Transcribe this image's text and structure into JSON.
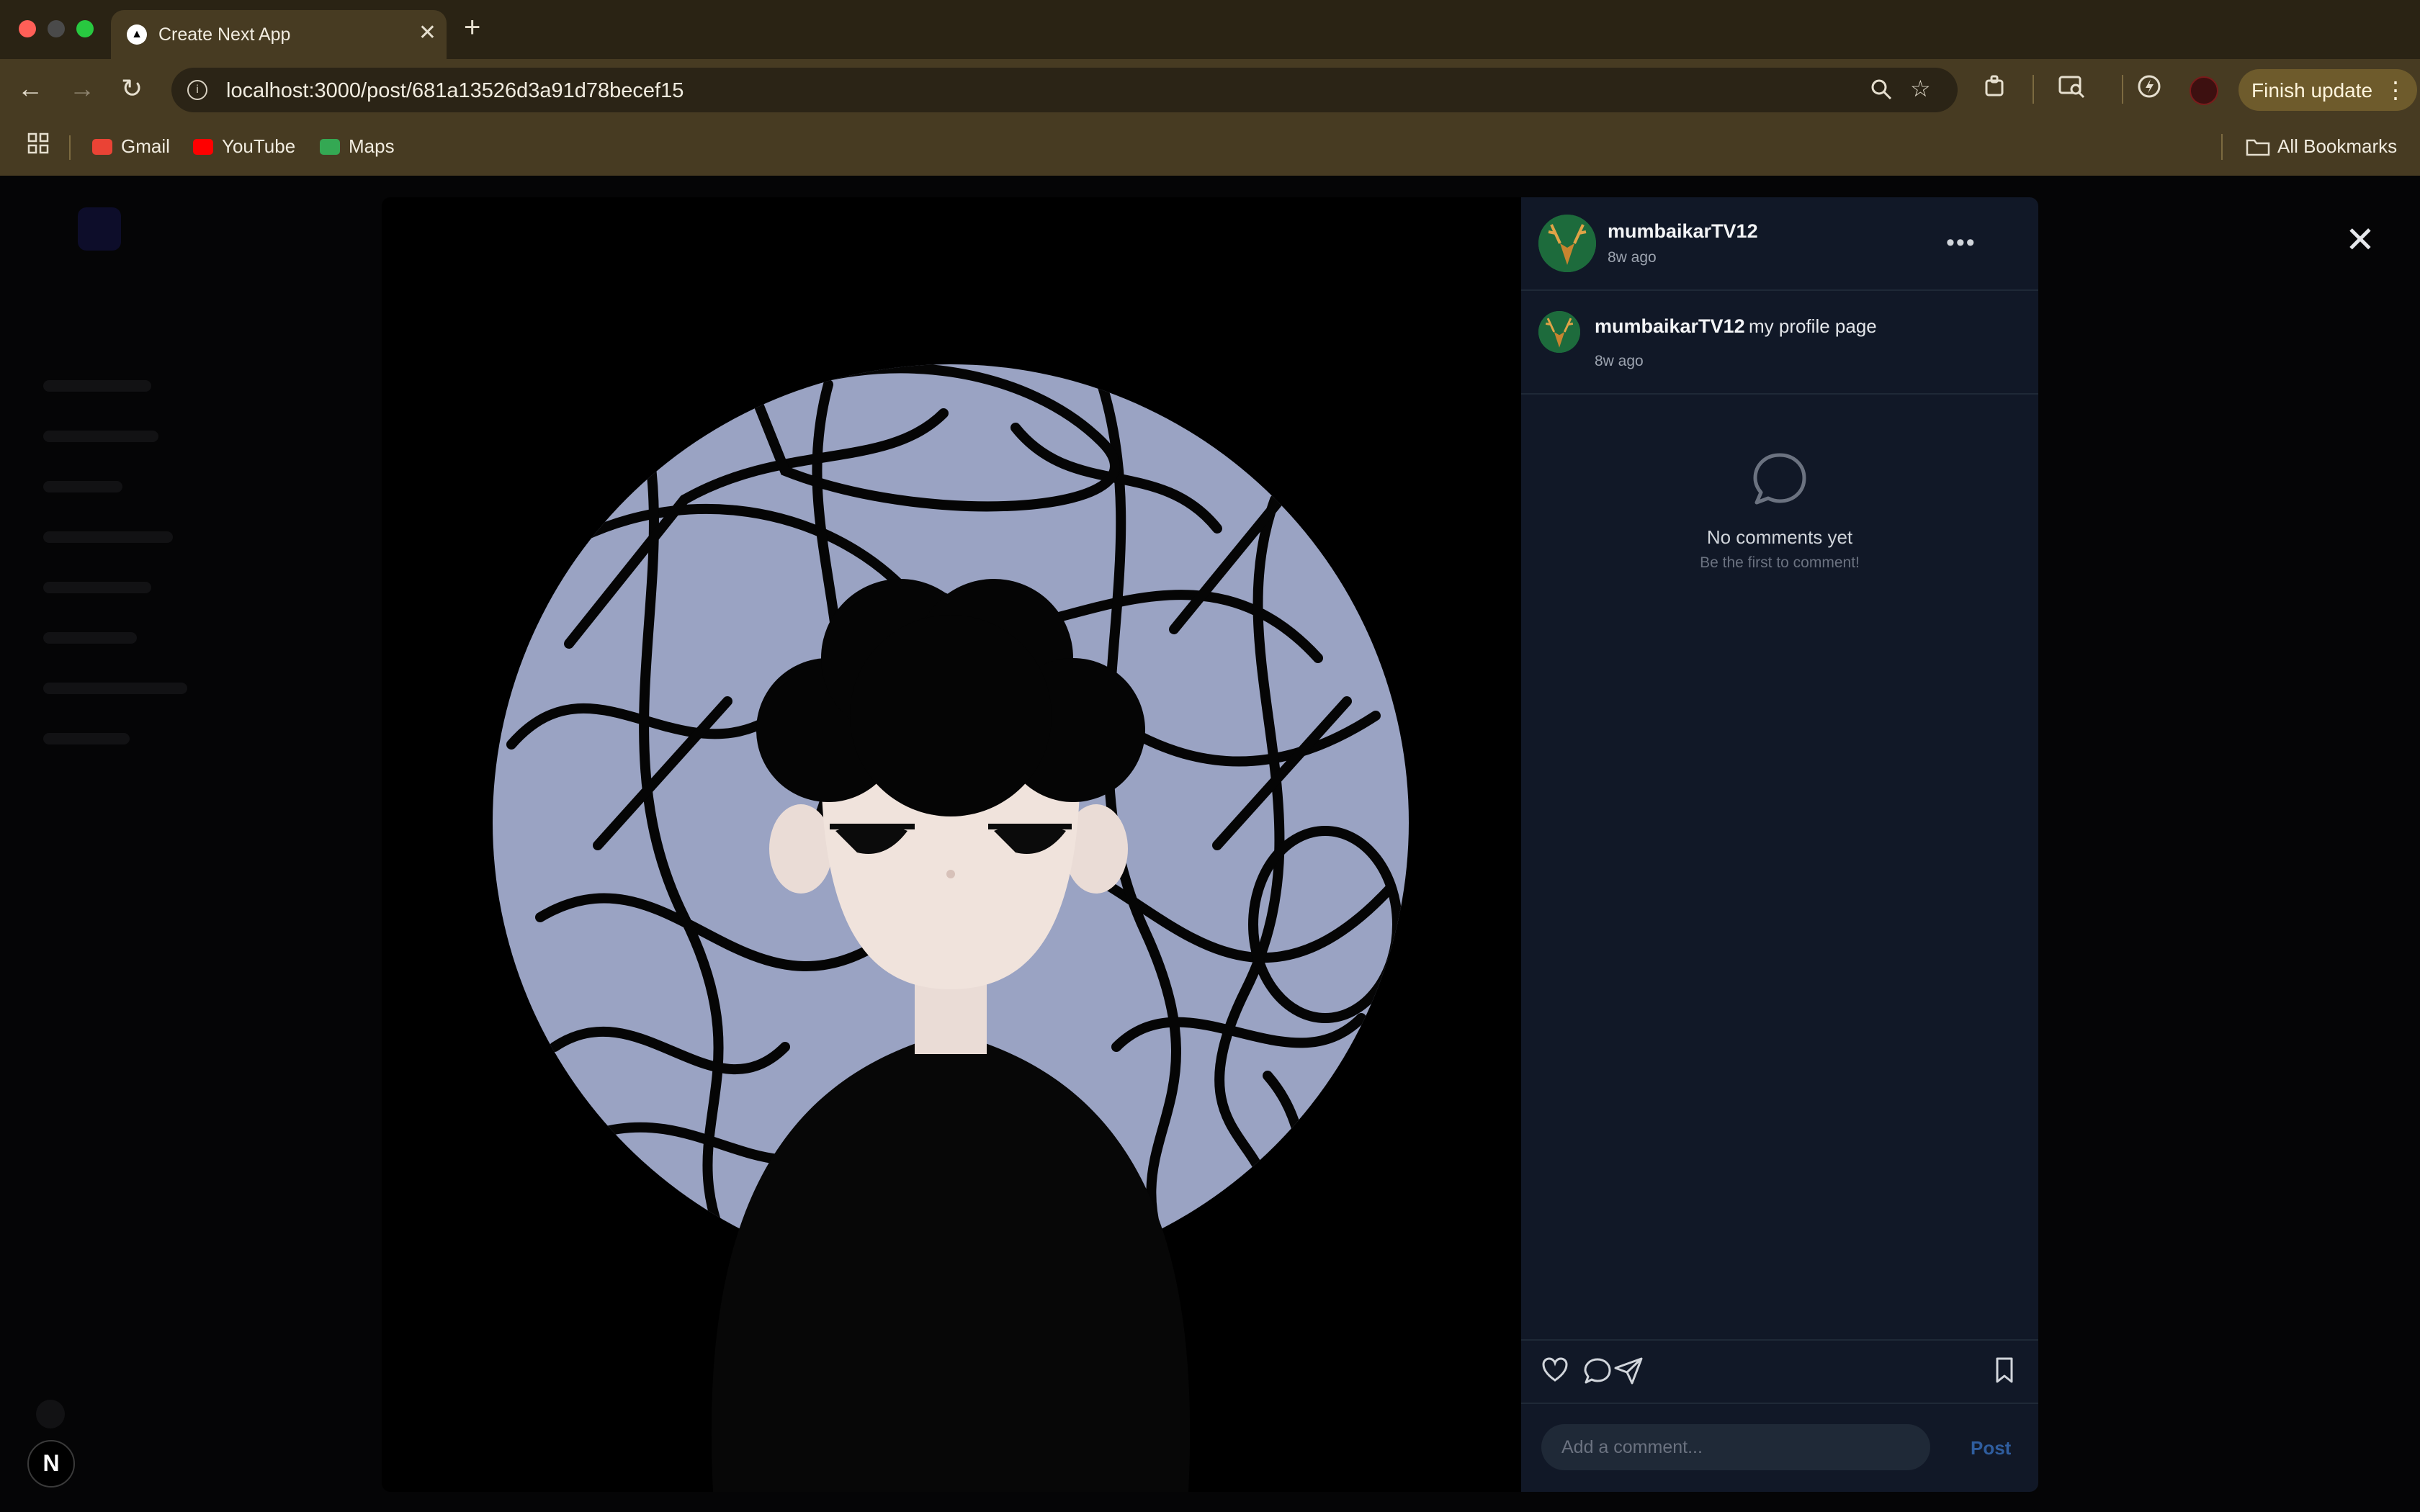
{
  "browser": {
    "tab_title": "Create Next App",
    "tab_favicon": "▲",
    "url": "localhost:3000/post/681a13526d3a91d78becef15",
    "finish_update_label": "Finish update",
    "bookmarks": [
      {
        "label": "Gmail",
        "icon": "gmail-icon",
        "color": "#ea4335"
      },
      {
        "label": "YouTube",
        "icon": "youtube-icon",
        "color": "#ff0000"
      },
      {
        "label": "Maps",
        "icon": "maps-icon",
        "color": "#34a853"
      }
    ],
    "all_bookmarks_label": "All Bookmarks"
  },
  "post": {
    "author": "mumbaikarTV12",
    "time_ago": "8w ago",
    "caption_author": "mumbaikarTV12",
    "caption": "my profile page",
    "caption_time": "8w ago",
    "image_icon": "cartoon-profile-image"
  },
  "comments": {
    "empty_title": "No comments yet",
    "empty_subtitle": "Be the first to comment!",
    "input_placeholder": "Add a comment...",
    "post_label": "Post"
  },
  "app": {
    "dev_badge": "N"
  },
  "colors": {
    "panel_bg": "#111827",
    "accent": "#2f5d9e",
    "chrome": "#473b22"
  }
}
